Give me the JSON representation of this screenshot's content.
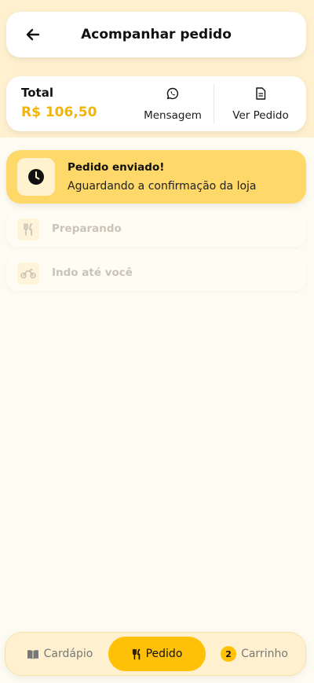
{
  "header": {
    "title": "Acompanhar pedido"
  },
  "summary": {
    "total_label": "Total",
    "total_value": "R$ 106,50",
    "message_label": "Mensagem",
    "view_order_label": "Ver Pedido"
  },
  "status": {
    "current": {
      "title": "Pedido enviado!",
      "subtitle": "Aguardando a confirmação da loja",
      "icon": "clock-icon"
    },
    "steps": [
      {
        "label": "Preparando",
        "icon": "utensils-icon"
      },
      {
        "label": "Indo até você",
        "icon": "motorcycle-icon"
      }
    ]
  },
  "bottom_nav": {
    "items": [
      {
        "label": "Cardápio",
        "icon": "book-icon",
        "active": false
      },
      {
        "label": "Pedido",
        "icon": "utensils-icon",
        "active": true
      },
      {
        "label": "Carrinho",
        "badge": "2",
        "active": false
      }
    ]
  },
  "colors": {
    "accent": "#ffc107",
    "accent_light": "#ffd86a",
    "price": "#f5b400",
    "band": "#fff1cf"
  }
}
